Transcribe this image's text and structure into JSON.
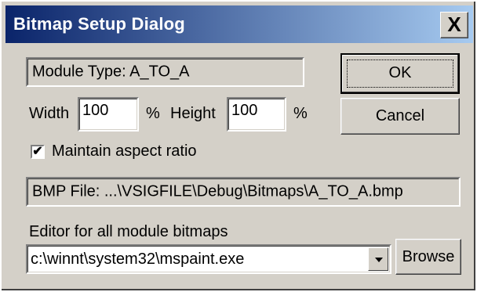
{
  "window": {
    "title": "Bitmap Setup Dialog",
    "close_label": "X"
  },
  "module_type": "Module Type: A_TO_A",
  "size": {
    "width_label": "Width",
    "width_value": "100",
    "width_unit": "%",
    "height_label": "Height",
    "height_value": "100",
    "height_unit": "%"
  },
  "aspect": {
    "label": "Maintain aspect ratio",
    "checked": true,
    "check_glyph": "✔"
  },
  "bmp_file": "BMP File: ...\\VSIGFILE\\Debug\\Bitmaps\\A_TO_A.bmp",
  "editor": {
    "label": "Editor for all module bitmaps",
    "value": "c:\\winnt\\system32\\mspaint.exe",
    "browse_label": "Browse"
  },
  "buttons": {
    "ok_label": "OK",
    "cancel_label": "Cancel"
  }
}
